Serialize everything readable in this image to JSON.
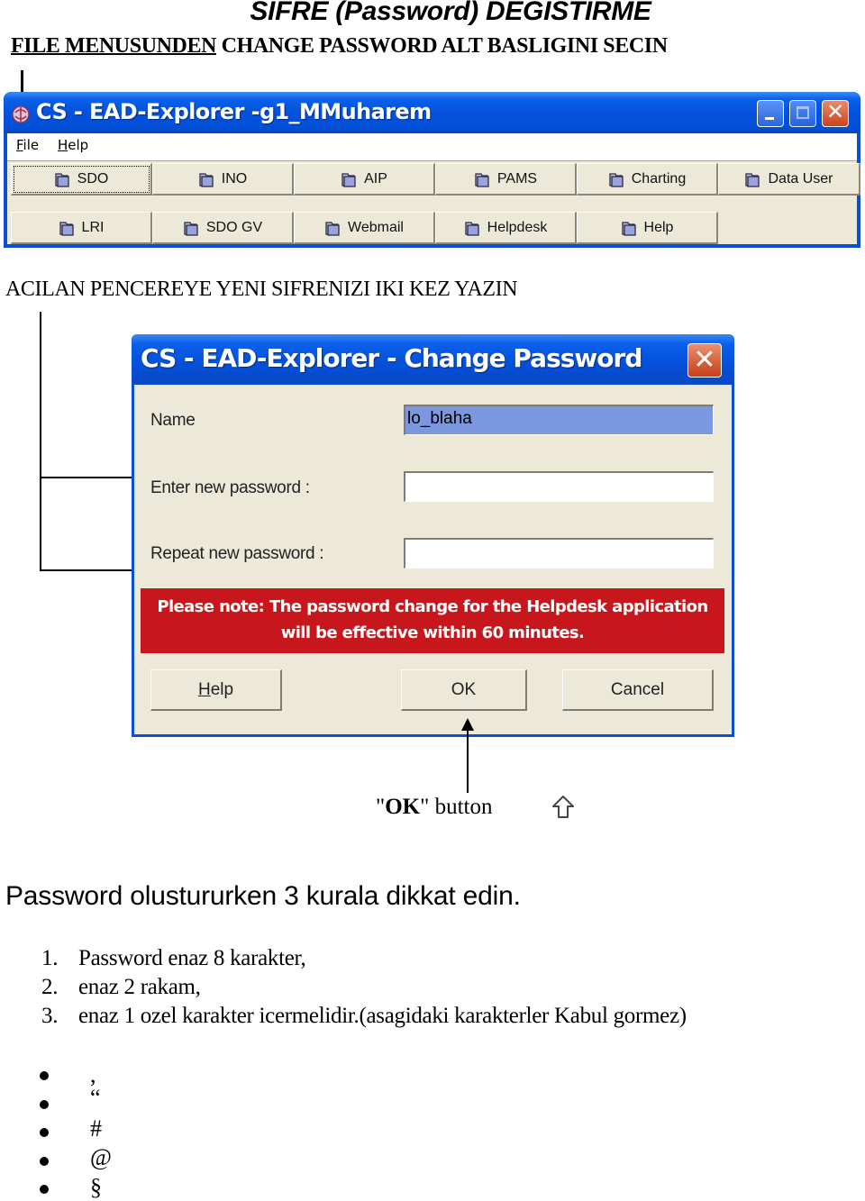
{
  "document": {
    "title": "SIFRE  (Password) DEGISTIRME",
    "instruction_1_underlined": "FILE MENUSUNDEN",
    "instruction_1_rest": " CHANGE PASSWORD ALT BASLIGINI SECIN",
    "instruction_2": "ACILAN PENCEREYE YENI SIFRENIZI IKI KEZ YAZIN"
  },
  "main_window": {
    "title": "CS - EAD-Explorer -g1_MMuharem",
    "controls": {
      "minimize": "minimize-icon",
      "maximize": "maximize-icon",
      "close": "close-icon"
    },
    "menu": [
      {
        "label": "File",
        "mnemonic": "F",
        "rest": "ile"
      },
      {
        "label": "Help",
        "mnemonic": "H",
        "rest": "elp"
      }
    ],
    "toolbar_row_1": [
      {
        "label": "SDO",
        "icon": "folder-icon",
        "focused": true
      },
      {
        "label": "INO",
        "icon": "folder-icon"
      },
      {
        "label": "AIP",
        "icon": "folder-icon"
      },
      {
        "label": "PAMS",
        "icon": "folder-icon"
      },
      {
        "label": "Charting",
        "icon": "folder-icon"
      },
      {
        "label": "Data User",
        "icon": "folder-icon"
      }
    ],
    "toolbar_row_2": [
      {
        "label": "LRI",
        "icon": "folder-icon"
      },
      {
        "label": "SDO GV",
        "icon": "folder-icon"
      },
      {
        "label": "Webmail",
        "icon": "folder-icon"
      },
      {
        "label": "Helpdesk",
        "icon": "folder-icon"
      },
      {
        "label": "Help",
        "icon": "folder-icon"
      }
    ]
  },
  "dialog": {
    "title": "CS - EAD-Explorer - Change Password",
    "fields": {
      "name": {
        "label": "Name",
        "value": "lo_blaha"
      },
      "new_password": {
        "label": "Enter new password :",
        "value": ""
      },
      "repeat_password": {
        "label": "Repeat new password :",
        "value": ""
      }
    },
    "note_line_1": "Please note: The password change for the Helpdesk application",
    "note_line_2": "will be effective within 60 minutes.",
    "buttons": {
      "help": {
        "label": "Help",
        "mnemonic": "H",
        "rest": "elp"
      },
      "ok": {
        "label": "OK"
      },
      "cancel": {
        "label": "Cancel"
      }
    }
  },
  "ok_caption": {
    "quote_open": "\"",
    "bold": "OK",
    "rest": "\" button"
  },
  "rules": {
    "heading": "Password olustururken 3 kurala dikkat edin.",
    "items": [
      {
        "num": "1.",
        "text": "Password enaz 8 karakter,"
      },
      {
        "num": "2.",
        "text": "enaz 2 rakam,"
      },
      {
        "num": "3.",
        "text": "enaz 1 ozel karakter icermelidir.(asagidaki karakterler Kabul gormez)"
      }
    ],
    "forbidden_chars": [
      ",",
      "“",
      "#",
      "@",
      "§"
    ]
  },
  "colors": {
    "xp_title_blue": "#0451dc",
    "dialog_face": "#ece9d8",
    "note_red": "#c8171c",
    "selection_blue": "#7b97e0"
  }
}
